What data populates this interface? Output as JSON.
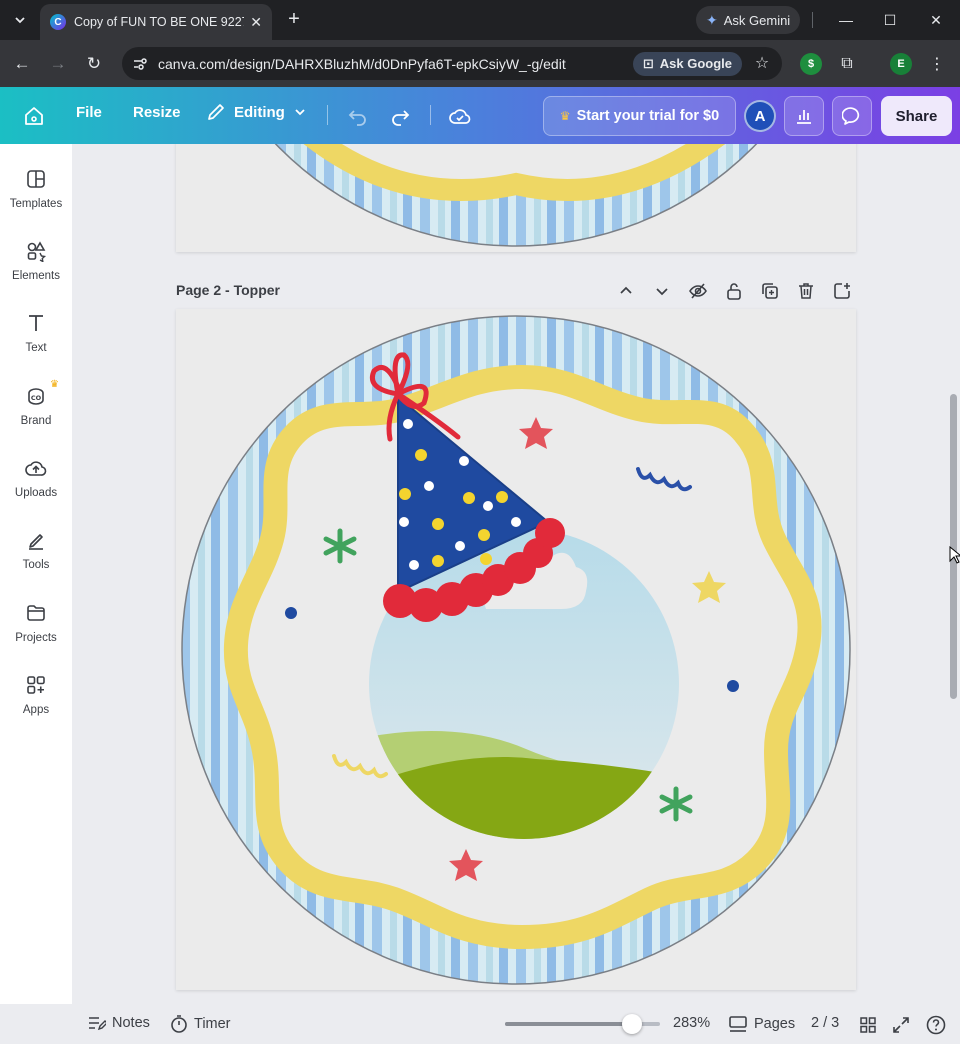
{
  "browser": {
    "tab_title": "Copy of FUN TO BE ONE 9227 T",
    "url": "canva.com/design/DAHRXBluzhM/d0DnPyfa6T-epkCsiyW_-g/edit",
    "ask_gemini": "Ask Gemini",
    "ask_google": "Ask Google",
    "profile_initial": "E"
  },
  "canva_bar": {
    "file": "File",
    "resize": "Resize",
    "editing": "Editing",
    "trial": "Start your trial for $0",
    "avatar_initial": "A",
    "share": "Share"
  },
  "sidebar": {
    "items": [
      {
        "label": "Templates",
        "icon": "templates-icon"
      },
      {
        "label": "Elements",
        "icon": "elements-icon"
      },
      {
        "label": "Text",
        "icon": "text-icon"
      },
      {
        "label": "Brand",
        "icon": "brand-icon"
      },
      {
        "label": "Uploads",
        "icon": "uploads-icon"
      },
      {
        "label": "Tools",
        "icon": "tools-icon"
      },
      {
        "label": "Projects",
        "icon": "projects-icon"
      },
      {
        "label": "Apps",
        "icon": "apps-icon"
      }
    ]
  },
  "page2": {
    "title": "Page 2 - Topper"
  },
  "footer": {
    "notes": "Notes",
    "timer": "Timer",
    "zoom_percent": 0.82,
    "zoom": "283%",
    "pages": "Pages",
    "page_count": "2 / 3"
  },
  "colors": {
    "brand_gradient_start": "#1bbfc4",
    "brand_gradient_end": "#7b3fe4",
    "frame_yellow": "#eed764",
    "hat_blue": "#1f4aa0",
    "pom_red": "#e12a3a",
    "grass_green": "#85a714"
  }
}
